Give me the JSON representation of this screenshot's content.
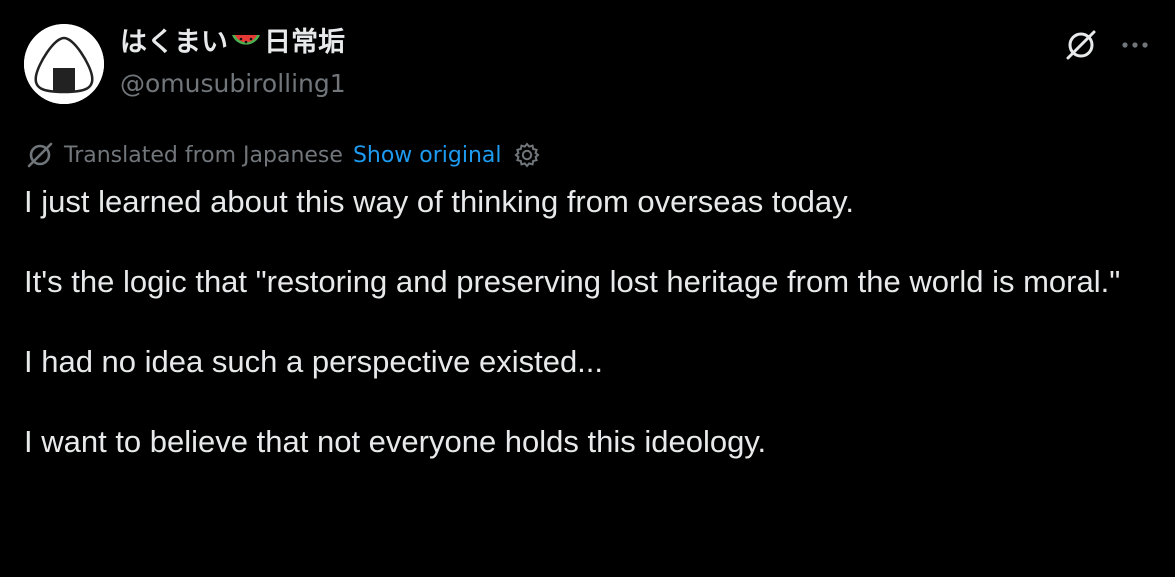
{
  "author": {
    "name_before_emoji": "はくまい",
    "name_emoji": "watermelon-emoji",
    "name_after_emoji": "日常垢",
    "handle": "@omusubirolling1",
    "avatar_icon": "onigiri-icon"
  },
  "header_actions": {
    "grok_icon": "grok-icon",
    "more_icon": "more-horizontal-icon"
  },
  "translation": {
    "icon": "grok-icon",
    "label": "Translated from Japanese",
    "show_original": "Show original",
    "settings_icon": "gear-icon"
  },
  "tweet": {
    "paragraphs": [
      "I just learned about this way of thinking from overseas today.",
      "It's the logic that \"restoring and preserving lost heritage from the world is moral.\"",
      "I had no idea such a perspective existed...",
      "I want to believe that not everyone holds this ideology."
    ]
  },
  "colors": {
    "background": "#000000",
    "primary_text": "#e7e9ea",
    "secondary_text": "#71767b",
    "link": "#1d9bf0"
  }
}
